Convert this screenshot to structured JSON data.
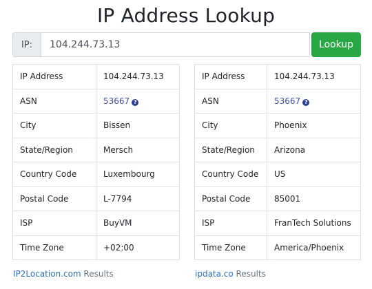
{
  "title": "IP Address Lookup",
  "search": {
    "prefix": "IP:",
    "value": "104.244.73.13",
    "button_label": "Lookup"
  },
  "results": [
    {
      "rows": [
        {
          "label": "IP Address",
          "value": "104.244.73.13"
        },
        {
          "label": "ASN",
          "value": "53667",
          "link": true,
          "help": "?"
        },
        {
          "label": "City",
          "value": "Bissen"
        },
        {
          "label": "State/Region",
          "value": "Mersch"
        },
        {
          "label": "Country Code",
          "value": "Luxembourg"
        },
        {
          "label": "Postal Code",
          "value": "L-7794"
        },
        {
          "label": "ISP",
          "value": "BuyVM"
        },
        {
          "label": "Time Zone",
          "value": "+02:00"
        }
      ],
      "source_link": "IP2Location.com",
      "source_suffix": " Results"
    },
    {
      "rows": [
        {
          "label": "IP Address",
          "value": "104.244.73.13"
        },
        {
          "label": "ASN",
          "value": "53667",
          "link": true,
          "help": "?"
        },
        {
          "label": "City",
          "value": "Phoenix"
        },
        {
          "label": "State/Region",
          "value": "Arizona"
        },
        {
          "label": "Country Code",
          "value": "US"
        },
        {
          "label": "Postal Code",
          "value": "85001"
        },
        {
          "label": "ISP",
          "value": "FranTech Solutions"
        },
        {
          "label": "Time Zone",
          "value": "America/Phoenix"
        }
      ],
      "source_link": "ipdata.co",
      "source_suffix": " Results"
    }
  ],
  "colors": {
    "lookup_button": "#28a745",
    "link": "#2c6fb8",
    "border": "#dee2e6"
  }
}
